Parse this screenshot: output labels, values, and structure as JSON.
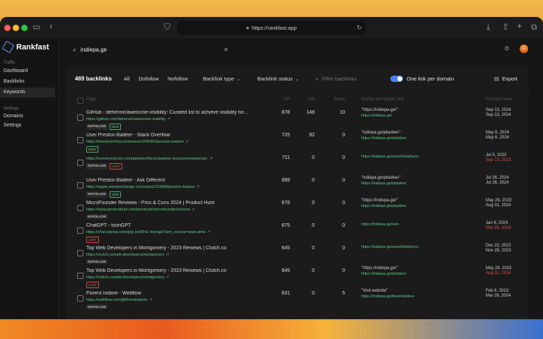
{
  "browser": {
    "url": "https://rankfast.app"
  },
  "brand": {
    "name": "Rankfast"
  },
  "sidebar": {
    "section_traffic": "Traffic",
    "items_traffic": [
      "Dashboard",
      "Backlinks",
      "Keywords"
    ],
    "section_settings": "Settings",
    "items_settings": [
      "Domains",
      "Settings"
    ],
    "active": "Keywords"
  },
  "search": {
    "value": "indiepa.ge"
  },
  "header": {
    "avatar_initial": "D"
  },
  "filters": {
    "count": "469 backlinks",
    "all": "All",
    "dofollow": "Dofollow",
    "nofollow": "Nofollow",
    "backlink_type": "Backlink type",
    "backlink_status": "Backlink status",
    "filter_placeholder": "Filter backlinks",
    "one_per_domain": "One link per domain",
    "one_per_domain_on": true,
    "export": "Export"
  },
  "table": {
    "columns": [
      "Page",
      "DR",
      "UR",
      "Spam",
      "Anchor and target URL",
      "First/last seen"
    ],
    "rows": [
      {
        "title": "GitHub - dehenne/awesome-visibility: Curated list to achieve visibility for...",
        "url": "https://github.com/dehenne/awesome-visibility",
        "b1": "NOFOLLOW",
        "b2": "NEW",
        "dr": "878",
        "ur": "148",
        "spam": "10",
        "anchor": "\"https://indiepa.ge/\"",
        "target": "https://indiepa.ge/",
        "first": "Sep 13, 2024",
        "last": "Sep 13, 2024"
      },
      {
        "title": "User Preston Badeer - Stack Overflow",
        "url": "https://stackoverflow.com/users/1696363/preston-badeer",
        "b1": "NEW",
        "b2": "",
        "dr": "725",
        "ur": "92",
        "spam": "0",
        "anchor": "\"indiepa.ge/pbadeer\"",
        "target": "https://indiepa.ge/pbadeer",
        "first": "May 6, 2024",
        "last": "May 6, 2024"
      },
      {
        "title": "",
        "url": "https://community.wix.com/partners/forum/partner-announcements/wix-",
        "b1": "NOFOLLOW",
        "b2": "LOST",
        "dr": "711",
        "ur": "0",
        "spam": "0",
        "anchor": "",
        "target": "https://indiepa.ge/sewellstephens",
        "first": "Jul 5, 2023",
        "last": "Sep 13, 2023"
      },
      {
        "title": "User Preston Badeer - Ask Different",
        "url": "https://apple.stackexchange.com/users/153968/preston-badeer",
        "b1": "NOFOLLOW",
        "b2": "NEW",
        "dr": "689",
        "ur": "0",
        "spam": "0",
        "anchor": "\"indiepa.ge/pbadeer\"",
        "target": "https://indiepa.ge/pbadeer",
        "first": "Jul 26, 2024",
        "last": "Jul 26, 2024"
      },
      {
        "title": "MicroFounder Reviews - Pros & Cons 2024 | Product Hunt",
        "url": "https://www.producthunt.com/products/microfounder/reviews",
        "b1": "NOFOLLOW",
        "b2": "",
        "dr": "678",
        "ur": "0",
        "spam": "0",
        "anchor": "\"https://indiepa.ge/\"",
        "target": "https://indiepa.ge/pbadeer",
        "first": "May 29, 2023",
        "last": "Aug 31, 2024"
      },
      {
        "title": "ChatGPT - toonGPT",
        "url": "https://chat.openai.com/g/g-Jsx9PsL-toongpt?utm_source=www.altrw",
        "b1": "LOST",
        "b2": "",
        "dr": "675",
        "ur": "0",
        "spam": "0",
        "anchor": "",
        "target": "https://indiepa.ge/vish",
        "first": "Jan 8, 2024",
        "last": "Mar 28, 2024"
      },
      {
        "title": "Top Web Developers in Montgomery - 2023 Reviews | Clutch.co",
        "url": "https://clutch.co/web-developers/montgomery",
        "b1": "NOFOLLOW",
        "b2": "",
        "dr": "645",
        "ur": "0",
        "spam": "0",
        "anchor": "",
        "target": "https://indiepa.ge/sewellstephens",
        "first": "Dec 22, 2022",
        "last": "Nov 28, 2023"
      },
      {
        "title": "Top Web Developers in Montgomery - 2023 Reviews | Clutch.co",
        "url": "https://clutch.co/web-developers/montgomery",
        "b1": "LOST",
        "b2": "",
        "dr": "645",
        "ur": "0",
        "spam": "0",
        "anchor": "\"https://indiepa.ge/\"",
        "target": "https://indiepa.ge/pbadeer",
        "first": "May 29, 2023",
        "last": "Aug 31, 2024"
      },
      {
        "title": "Florent Isidore - Webflow",
        "url": "https://webflow.com/@florentisidore",
        "b1": "NOFOLLOW",
        "b2": "",
        "dr": "631",
        "ur": "0",
        "spam": "5",
        "anchor": "\"Visit website\"",
        "target": "https://indiepa.ge/florentisidore",
        "first": "Feb 6, 2023",
        "last": "Mar 28, 2024"
      }
    ]
  }
}
